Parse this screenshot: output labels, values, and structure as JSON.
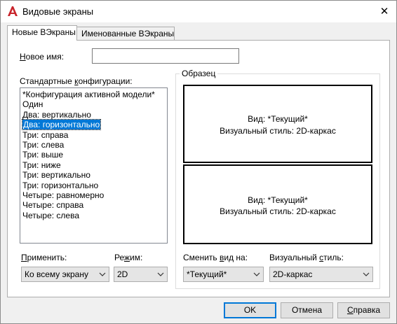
{
  "window": {
    "title": "Видовые экраны",
    "close_glyph": "✕"
  },
  "tabs": [
    {
      "label": "Новые ВЭкраны",
      "active": true
    },
    {
      "label": "Именованные ВЭкраны",
      "active": false
    }
  ],
  "new_name": {
    "label_accel": "Н",
    "label_rest": "овое имя:",
    "value": ""
  },
  "standard": {
    "label_pre": "Стандартные ",
    "label_accel": "к",
    "label_post": "онфигурации:",
    "items": [
      "*Конфигурация активной модели*",
      "Один",
      "Два: вертикально",
      "Два: горизонтально",
      "Три: справа",
      "Три: слева",
      "Три: выше",
      "Три: ниже",
      "Три: вертикально",
      "Три: горизонтально",
      "Четыре: равномерно",
      "Четыре: справа",
      "Четыре: слева"
    ],
    "selected_index": 3
  },
  "preview": {
    "title": "Образец",
    "top": {
      "view": "Вид: *Текущий*",
      "style": "Визуальный стиль: 2D-каркас"
    },
    "bottom": {
      "view": "Вид: *Текущий*",
      "style": "Визуальный стиль: 2D-каркас"
    }
  },
  "apply": {
    "label_accel": "П",
    "label_rest": "рименить:",
    "value": "Ко всему экрану"
  },
  "mode": {
    "label_pre": "Ре",
    "label_accel": "ж",
    "label_post": "им:",
    "value": "2D"
  },
  "change_view": {
    "label_pre": "Сменить ",
    "label_accel": "в",
    "label_post": "ид на:",
    "value": "*Текущий*"
  },
  "visual_style": {
    "label_pre": "Визуальный ",
    "label_accel": "с",
    "label_post": "тиль:",
    "value": "2D-каркас"
  },
  "buttons": {
    "ok": "OK",
    "cancel": "Отмена",
    "help_accel": "С",
    "help_rest": "правка"
  },
  "colors": {
    "selection": "#0078d7",
    "app_icon": "#c8242b",
    "default_button_border": "#0078d7"
  },
  "icons": {
    "app": "autocad-logo-icon",
    "dropdown": "chevron-down-icon",
    "close": "close-icon"
  }
}
